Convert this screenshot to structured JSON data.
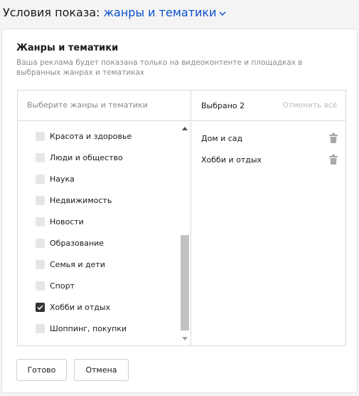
{
  "header": {
    "label": "Условия показа:",
    "value": "жанры и тематики"
  },
  "card": {
    "title": "Жанры и тематики",
    "description": "Ваша реклама будет показана только на видеоконтенте и площадках в выбранных жанрах и тематиках"
  },
  "picker": {
    "search_placeholder": "Выберите жанры и тематики",
    "items": [
      {
        "label": "Красота и здоровье",
        "checked": false
      },
      {
        "label": "Люди и общество",
        "checked": false
      },
      {
        "label": "Наука",
        "checked": false
      },
      {
        "label": "Недвижимость",
        "checked": false
      },
      {
        "label": "Новости",
        "checked": false
      },
      {
        "label": "Образование",
        "checked": false
      },
      {
        "label": "Семья и дети",
        "checked": false
      },
      {
        "label": "Спорт",
        "checked": false
      },
      {
        "label": "Хобби и отдых",
        "checked": true
      },
      {
        "label": "Шоппинг, покупки",
        "checked": false
      }
    ],
    "selected_count_label": "Выбрано 2",
    "clear_all_label": "Отменить всё",
    "selected": [
      {
        "label": "Дом и сад"
      },
      {
        "label": "Хобби и отдых"
      }
    ]
  },
  "buttons": {
    "done": "Готово",
    "cancel": "Отмена"
  },
  "colors": {
    "link_blue": "#0b4fcf",
    "checkbox_checked": "#333333",
    "checkbox_unchecked": "#e6e6e6"
  }
}
